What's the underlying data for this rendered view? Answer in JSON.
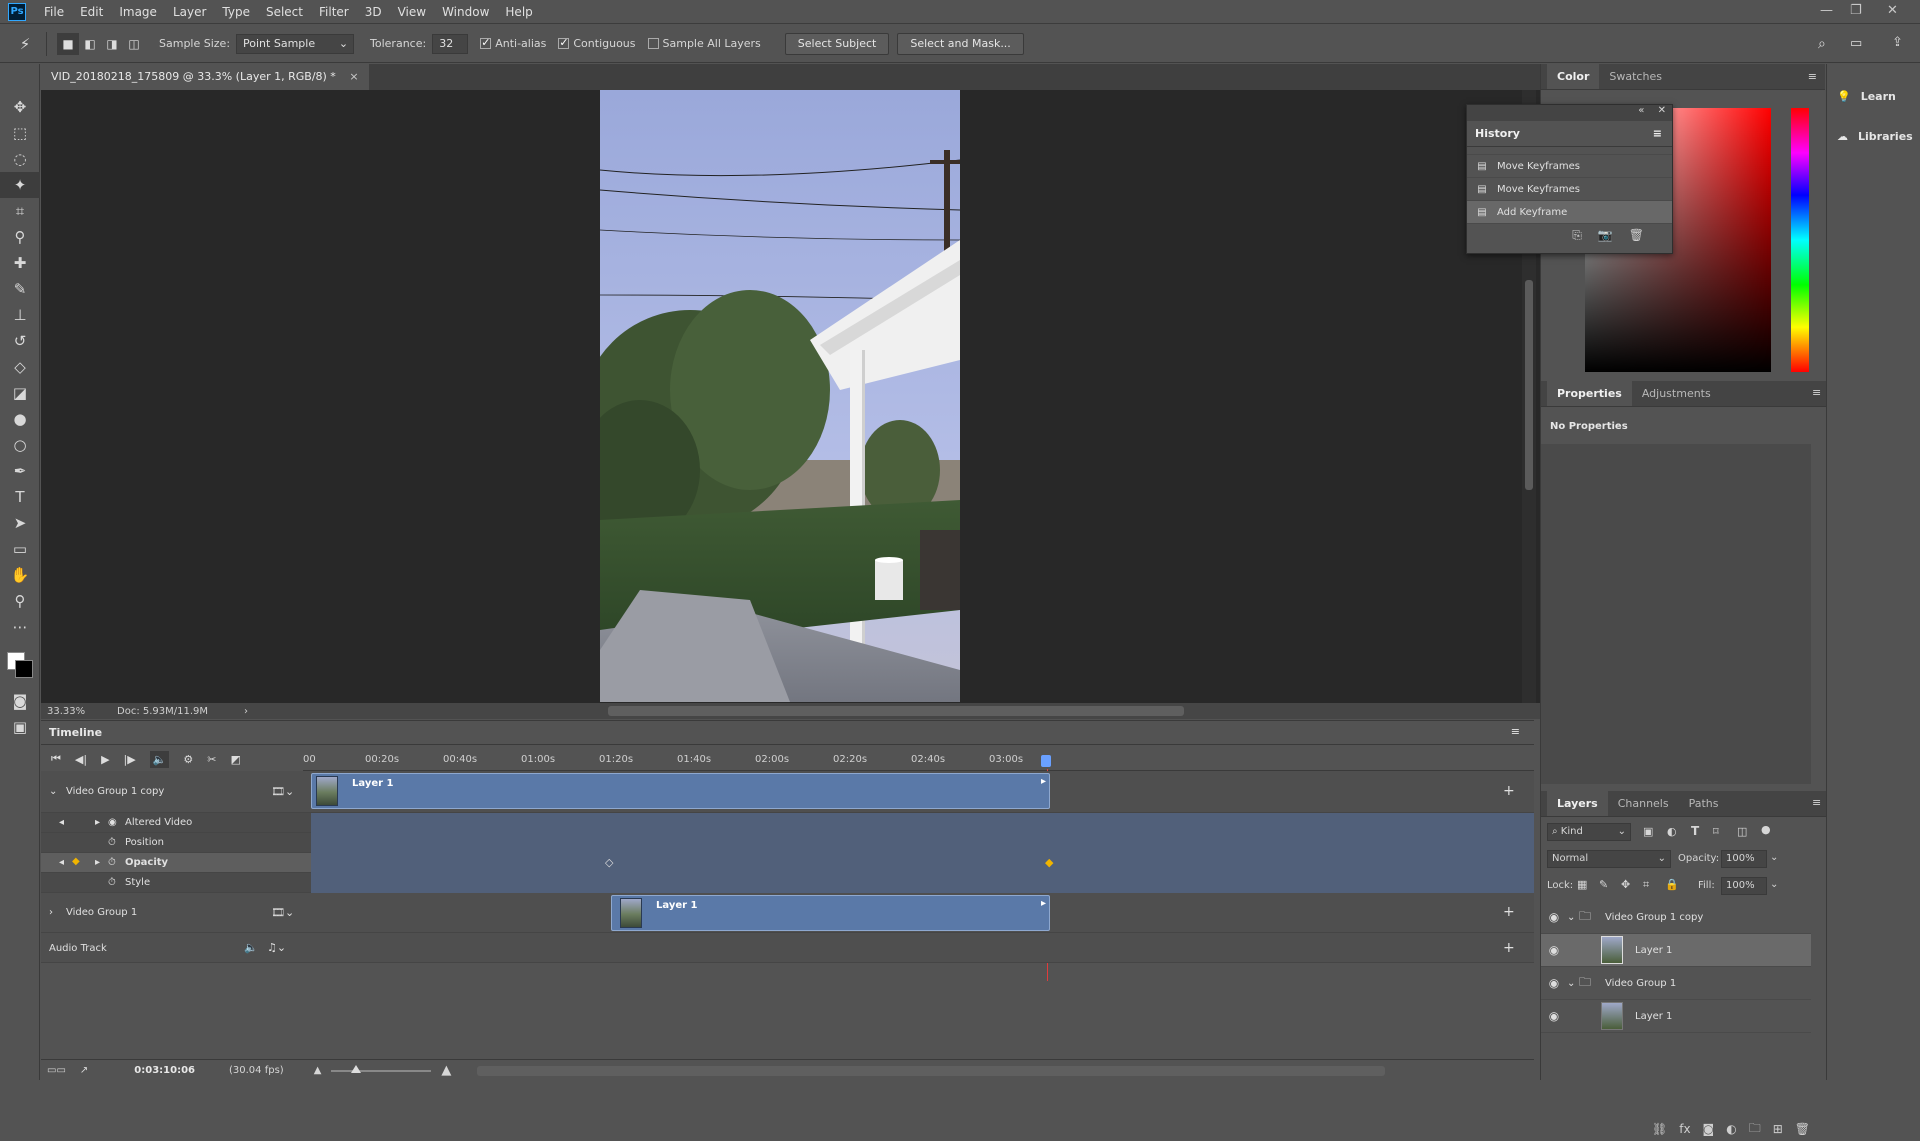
{
  "app": {
    "logo": "Ps"
  },
  "menubar": {
    "items": [
      "File",
      "Edit",
      "Image",
      "Layer",
      "Type",
      "Select",
      "Filter",
      "3D",
      "View",
      "Window",
      "Help"
    ]
  },
  "options": {
    "sample_size_label": "Sample Size:",
    "sample_size_value": "Point Sample",
    "tolerance_label": "Tolerance:",
    "tolerance_value": "32",
    "anti_alias": "Anti-alias",
    "contiguous": "Contiguous",
    "sample_all_layers": "Sample All Layers",
    "select_subject": "Select Subject",
    "select_and_mask": "Select and Mask..."
  },
  "document": {
    "tab_title": "VID_20180218_175809 @ 33.3% (Layer 1, RGB/8) *",
    "zoom": "33.33%",
    "doc_size": "Doc: 5.93M/11.9M"
  },
  "timeline": {
    "title": "Timeline",
    "ticks": [
      "00",
      "00:20s",
      "00:40s",
      "01:00s",
      "01:20s",
      "01:40s",
      "02:00s",
      "02:20s",
      "02:40s",
      "03:00s"
    ],
    "tracks": {
      "group_copy": "Video Group 1 copy",
      "clip_layer": "Layer 1",
      "altered_video": "Altered Video",
      "position": "Position",
      "opacity": "Opacity",
      "style": "Style",
      "group": "Video Group 1",
      "clip2_layer": "Layer 1",
      "audio": "Audio Track"
    },
    "timecode": "0:03:10:06",
    "fps": "(30.04 fps)"
  },
  "history": {
    "title": "History",
    "items": [
      "Move Keyframes",
      "Move Keyframes",
      "Add Keyframe"
    ]
  },
  "color_panel": {
    "tabs": [
      "Color",
      "Swatches"
    ]
  },
  "properties_panel": {
    "tabs": [
      "Properties",
      "Adjustments"
    ],
    "empty": "No Properties"
  },
  "layers_panel": {
    "tabs": [
      "Layers",
      "Channels",
      "Paths"
    ],
    "filter_kind": "Kind",
    "blend_mode": "Normal",
    "opacity_label": "Opacity:",
    "opacity_value": "100%",
    "lock_label": "Lock:",
    "fill_label": "Fill:",
    "fill_value": "100%",
    "layers": [
      "Video Group 1 copy",
      "Layer 1",
      "Video Group 1",
      "Layer 1"
    ]
  },
  "right_column": {
    "learn": "Learn",
    "libraries": "Libraries"
  },
  "colors": {
    "accent": "#31a8ff",
    "clip": "#5a79a8",
    "playhead": "#e03c3c",
    "keyframe": "#f0b400"
  }
}
